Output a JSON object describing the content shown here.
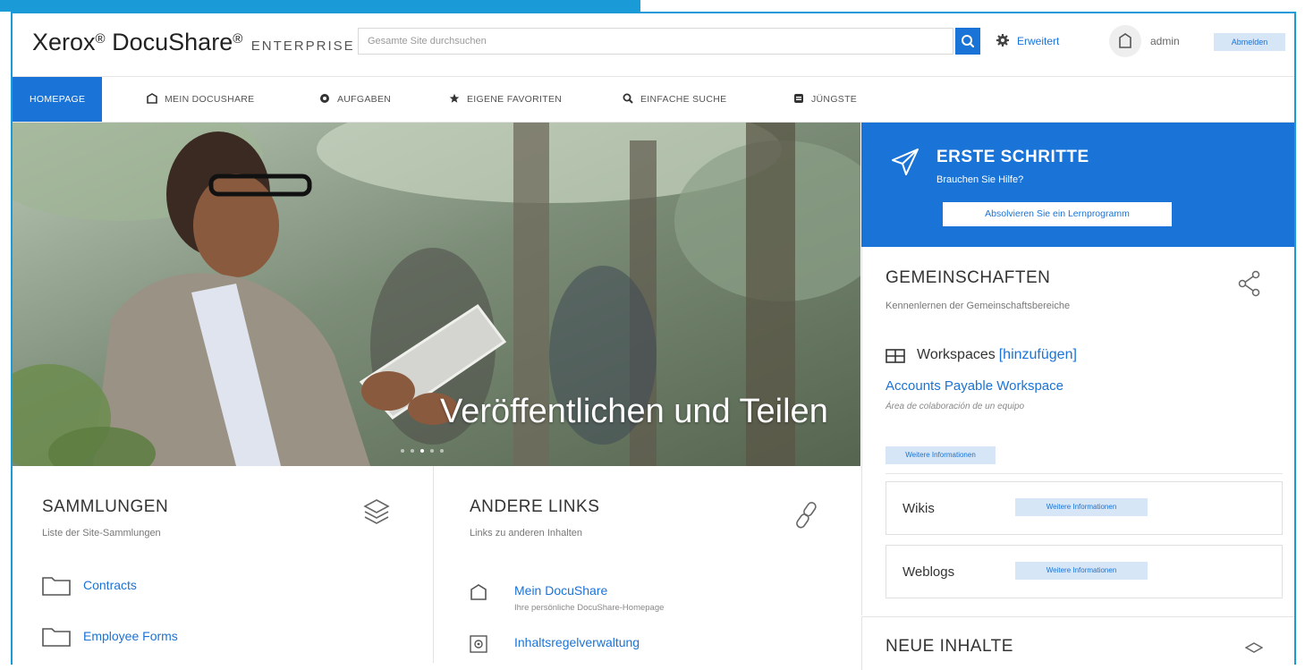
{
  "header": {
    "logo_main": "Xerox",
    "logo_product": "DocuShare",
    "logo_reg": "®",
    "logo_edition": "ENTERPRISE",
    "search_placeholder": "Gesamte Site durchsuchen",
    "advanced_label": "Erweitert",
    "user_name": "admin",
    "logout_label": "Abmelden"
  },
  "nav": {
    "items": [
      {
        "label": "HOMEPAGE",
        "icon": "none",
        "active": true
      },
      {
        "label": "MEIN DOCUSHARE",
        "icon": "home-icon"
      },
      {
        "label": "AUFGABEN",
        "icon": "gear-icon"
      },
      {
        "label": "EIGENE FAVORITEN",
        "icon": "star-icon"
      },
      {
        "label": "EINFACHE SUCHE",
        "icon": "search-icon"
      },
      {
        "label": "JÜNGSTE",
        "icon": "recent-icon"
      }
    ]
  },
  "hero": {
    "caption": "Veröffentlichen und Teilen",
    "slides": 5,
    "active_slide": 3
  },
  "getting_started": {
    "title": "ERSTE SCHRITTE",
    "subtitle": "Brauchen Sie Hilfe?",
    "button_label": "Absolvieren Sie ein Lernprogramm"
  },
  "communities": {
    "title": "GEMEINSCHAFTEN",
    "subtitle": "Kennenlernen der Gemeinschaftsbereiche",
    "workspaces_label": "Workspaces",
    "workspaces_add": "[hinzufügen]",
    "workspace_link": "Accounts Payable Workspace",
    "workspace_desc": "Área de colaboración de un equipo",
    "more_info": "Weitere Informationen",
    "wikis_label": "Wikis",
    "weblogs_label": "Weblogs"
  },
  "new_content": {
    "title": "NEUE INHALTE"
  },
  "collections": {
    "title": "SAMMLUNGEN",
    "subtitle": "Liste der Site-Sammlungen",
    "items": [
      "Contracts",
      "Employee Forms"
    ]
  },
  "other_links": {
    "title": "ANDERE LINKS",
    "subtitle": "Links zu anderen Inhalten",
    "items": [
      {
        "title": "Mein DocuShare",
        "desc": "Ihre persönliche DocuShare-Homepage"
      },
      {
        "title": "Inhaltsregelverwaltung",
        "desc": ""
      }
    ]
  },
  "colors": {
    "accent": "#1a73d6",
    "frame": "#1a9ad6",
    "light_button": "#d6e6f6"
  }
}
